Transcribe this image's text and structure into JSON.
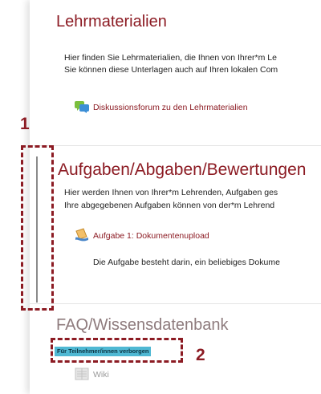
{
  "colors": {
    "accent": "#8c1b23",
    "badge_background": "#4fb8d3"
  },
  "sections": [
    {
      "title": "Lehrmaterialien",
      "lines": [
        "Hier finden Sie Lehrmaterialien, die Ihnen von Ihrer*m Le",
        "Sie können diese Unterlagen auch auf Ihren lokalen Com"
      ],
      "items": [
        {
          "label": "Diskussionsforum zu den Lehrmaterialien",
          "icon": "forum-icon"
        }
      ]
    },
    {
      "title": "Aufgaben/Abgaben/Bewertungen",
      "lines": [
        "Hier werden Ihnen von Ihrer*m Lehrenden, Aufgaben ges",
        "Ihre abgegebenen Aufgaben können von der*m Lehrend"
      ],
      "items": [
        {
          "label": "Aufgabe 1: Dokumentenupload",
          "icon": "assignment-icon",
          "description": "Die Aufgabe besteht darin, ein beliebiges Dokume"
        }
      ]
    },
    {
      "title": "FAQ/Wissensdatenbank",
      "badge": "Für Teilnehmer/innen verborgen",
      "items": [
        {
          "label": "Wiki",
          "icon": "wiki-icon"
        }
      ]
    }
  ],
  "annotations": [
    {
      "number": "1"
    },
    {
      "number": "2"
    }
  ]
}
